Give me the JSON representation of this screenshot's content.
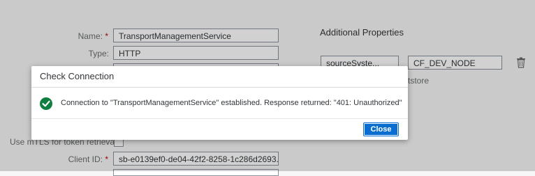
{
  "form": {
    "name_label": "Name:",
    "name_value": "TransportManagementService",
    "type_label": "Type:",
    "type_value": "HTTP",
    "required_mark": "*",
    "mtls_label": "Use mTLS for token retrieval",
    "client_id_label": "Client ID:",
    "client_id_value": "sb-e0139ef0-de04-42f2-8258-1c286d2693..."
  },
  "additional": {
    "title": "Additional Properties",
    "prop_key": "sourceSyste...",
    "prop_value": "CF_DEV_NODE",
    "hint_partial": "tstore"
  },
  "dialog": {
    "title": "Check Connection",
    "message": "Connection to \"TransportManagementService\" established. Response returned: \"401: Unauthorized\"",
    "close_label": "Close"
  },
  "colors": {
    "accent": "#0a6ed1",
    "success": "#107e3e",
    "required": "#bb0000"
  },
  "icons": {
    "status": "success-check-icon",
    "delete": "trash-icon"
  }
}
